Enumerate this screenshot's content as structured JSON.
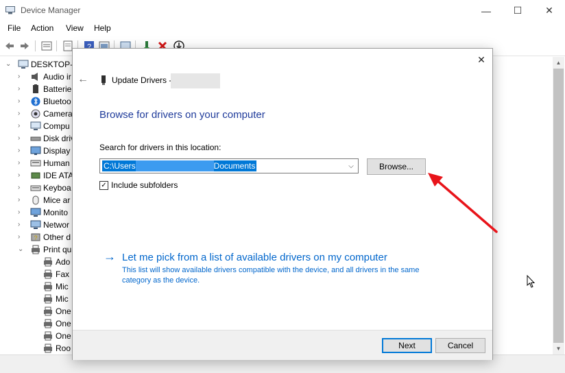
{
  "window": {
    "title": "Device Manager",
    "controls": [
      "minimize-icon",
      "maximize-icon",
      "close-icon"
    ]
  },
  "menu": {
    "file": "File",
    "action": "Action",
    "view": "View",
    "help": "Help"
  },
  "tree": {
    "root": "DESKTOP-B",
    "categories": [
      {
        "label": "Audio ir",
        "icon": "speaker-icon"
      },
      {
        "label": "Batterie",
        "icon": "battery-icon"
      },
      {
        "label": "Bluetoo",
        "icon": "bluetooth-icon"
      },
      {
        "label": "Camera",
        "icon": "camera-icon"
      },
      {
        "label": "Compu",
        "icon": "computer-icon"
      },
      {
        "label": "Disk driv",
        "icon": "disk-drive-icon"
      },
      {
        "label": "Display",
        "icon": "display-icon"
      },
      {
        "label": "Human",
        "icon": "hid-icon"
      },
      {
        "label": "IDE ATA",
        "icon": "ide-controller-icon"
      },
      {
        "label": "Keyboa",
        "icon": "keyboard-icon"
      },
      {
        "label": "Mice ar",
        "icon": "mouse-icon"
      },
      {
        "label": "Monito",
        "icon": "monitor-icon"
      },
      {
        "label": "Networ",
        "icon": "network-icon"
      },
      {
        "label": "Other d",
        "icon": "unknown-device-icon"
      },
      {
        "label": "Print qu",
        "icon": "printer-icon"
      }
    ],
    "print_queue_children": [
      "Ado",
      "Fax",
      "Mic",
      "Mic",
      "One",
      "One",
      "One",
      "Roo"
    ]
  },
  "dialog": {
    "header": "Update Drivers -",
    "heading": "Browse for drivers on your computer",
    "search_label": "Search for drivers in this location:",
    "path_prefix": "C:\\Users",
    "path_suffix": "Documents",
    "browse_label": "Browse...",
    "subfolders_label": "Include subfolders",
    "subfolders_checked": true,
    "pick_link": "Let me pick from a list of available drivers on my computer",
    "pick_description": "This list will show available drivers compatible with the device, and all drivers in the same category as the device.",
    "next_label": "Next",
    "cancel_label": "Cancel"
  },
  "colors": {
    "accent": "#0078d7",
    "link": "#0066cc",
    "heading": "#1e3a9a",
    "annotation": "#e8141a"
  }
}
